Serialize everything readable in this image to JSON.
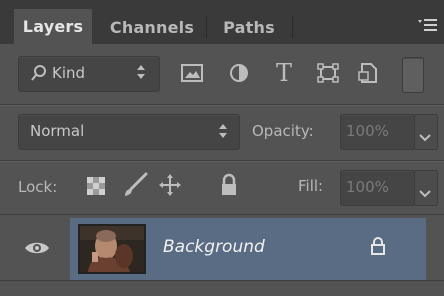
{
  "tabs": [
    {
      "label": "Layers",
      "active": true
    },
    {
      "label": "Channels",
      "active": false
    },
    {
      "label": "Paths",
      "active": false
    }
  ],
  "filter": {
    "kind_label": "Kind",
    "filter_icons": [
      "image-filter-icon",
      "adjustment-filter-icon",
      "type-filter-icon",
      "shape-filter-icon",
      "smart-object-filter-icon"
    ]
  },
  "blend": {
    "mode": "Normal",
    "opacity_label": "Opacity:",
    "opacity_value": "100%"
  },
  "lock": {
    "label": "Lock:",
    "fill_label": "Fill:",
    "fill_value": "100%",
    "lock_icons": [
      "lock-transparent-pixels-icon",
      "lock-image-pixels-icon",
      "lock-position-icon",
      "lock-all-icon"
    ]
  },
  "layers": [
    {
      "name": "Background",
      "visible": true,
      "locked": true,
      "selected": true
    }
  ],
  "colors": {
    "panel_bg": "#535353",
    "tabbar_bg": "#3a3a3a",
    "selected_row": "#5a6b84"
  }
}
